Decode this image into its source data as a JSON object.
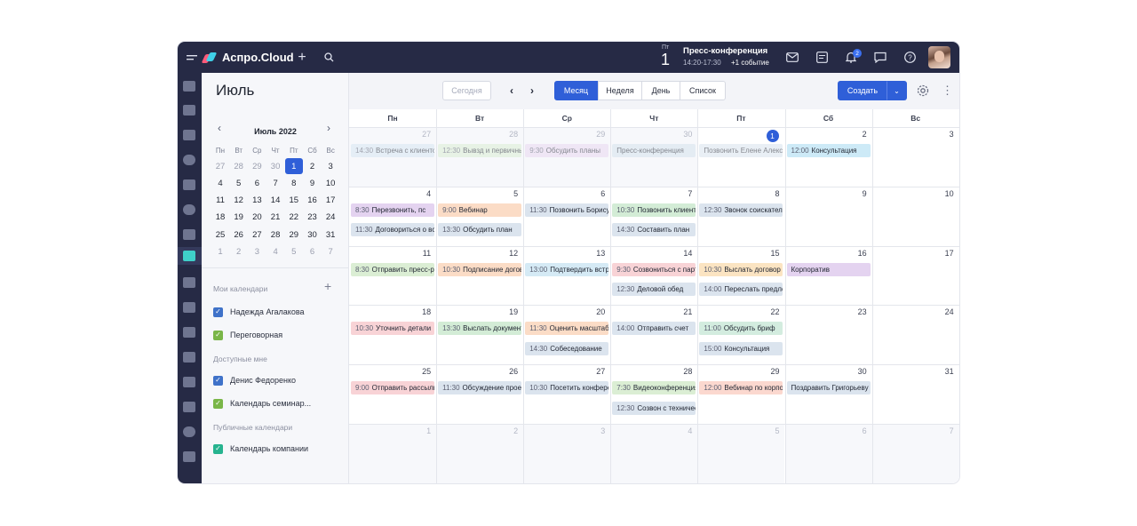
{
  "app": {
    "name": "Аспро.Cloud"
  },
  "topbar": {
    "event_day_label": "Пт",
    "event_day_num": "1",
    "event_title": "Пресс-конференция",
    "event_time": "14:20-17:30",
    "event_more": "+1 событие",
    "notif_count": "2"
  },
  "toolbar": {
    "month_title": "Июль",
    "today_label": "Сегодня",
    "views": [
      "Месяц",
      "Неделя",
      "День",
      "Список"
    ],
    "create_label": "Создать"
  },
  "mini_cal": {
    "title": "Июль 2022",
    "dow": [
      "Пн",
      "Вт",
      "Ср",
      "Чт",
      "Пт",
      "Сб",
      "Вс"
    ],
    "days": [
      [
        "27",
        "28",
        "29",
        "30",
        "1",
        "2",
        "3"
      ],
      [
        "4",
        "5",
        "6",
        "7",
        "8",
        "9",
        "10"
      ],
      [
        "11",
        "12",
        "13",
        "14",
        "15",
        "16",
        "17"
      ],
      [
        "18",
        "19",
        "20",
        "21",
        "22",
        "23",
        "24"
      ],
      [
        "25",
        "26",
        "27",
        "28",
        "29",
        "30",
        "31"
      ],
      [
        "1",
        "2",
        "3",
        "4",
        "5",
        "6",
        "7"
      ]
    ]
  },
  "sidebar": {
    "my_header": "Мои календари",
    "my": [
      "Надежда Агалакова",
      "Переговорная"
    ],
    "available_header": "Доступные мне",
    "available": [
      "Денис Федоренко",
      "Календарь семинар..."
    ],
    "public_header": "Публичные календари",
    "public": [
      "Календарь компании"
    ],
    "check_colors": [
      "#3f72c9",
      "#7ab648",
      "#3f72c9",
      "#7ab648",
      "#26b38f"
    ]
  },
  "grid": {
    "dow": [
      "Пн",
      "Вт",
      "Ср",
      "Чт",
      "Пт",
      "Сб",
      "Вс"
    ],
    "weeks": [
      [
        "27",
        "28",
        "29",
        "30",
        "1",
        "2",
        "3"
      ],
      [
        "4",
        "5",
        "6",
        "7",
        "8",
        "9",
        "10"
      ],
      [
        "11",
        "12",
        "13",
        "14",
        "15",
        "16",
        "17"
      ],
      [
        "18",
        "19",
        "20",
        "21",
        "22",
        "23",
        "24"
      ],
      [
        "25",
        "26",
        "27",
        "28",
        "29",
        "30",
        "31"
      ],
      [
        "1",
        "2",
        "3",
        "4",
        "5",
        "6",
        "7"
      ]
    ]
  },
  "events": [
    {
      "week": 0,
      "day": 0,
      "slot": 0,
      "time": "14:30",
      "title": "Встреча с клиентом",
      "color": "#d8e7f3",
      "past": true
    },
    {
      "week": 0,
      "day": 1,
      "slot": 0,
      "time": "12:30",
      "title": "Вывзд и первичный",
      "color": "#dbeed4",
      "past": true
    },
    {
      "week": 0,
      "day": 2,
      "slot": 0,
      "time": "9:30",
      "title": "Обсудить планы",
      "color": "#ead9f1",
      "past": true
    },
    {
      "week": 0,
      "day": 3,
      "slot": 0,
      "time": "",
      "title": "Пресс-конференция",
      "color": "#d5e3ee",
      "past": true
    },
    {
      "week": 0,
      "day": 4,
      "slot": 0,
      "time": "",
      "title": "Позвонить Елене Алексеевой",
      "color": "#d8e2ee",
      "past": true
    },
    {
      "week": 0,
      "day": 5,
      "slot": 0,
      "time": "12:00",
      "title": "Консультация",
      "color": "#cdeaf7",
      "past": false
    },
    {
      "week": 1,
      "day": 0,
      "slot": 0,
      "time": "8:30",
      "title": "Перезвонить, пс",
      "color": "#e4d3f0",
      "past": false
    },
    {
      "week": 1,
      "day": 0,
      "slot": 1,
      "time": "11:30",
      "title": "Договориться о встрече",
      "color": "#dbe4ee",
      "past": false
    },
    {
      "week": 1,
      "day": 1,
      "slot": 0,
      "time": "9:00",
      "title": "Вебинар",
      "color": "#fbdcc6",
      "past": false
    },
    {
      "week": 1,
      "day": 1,
      "slot": 1,
      "time": "13:30",
      "title": "Обсудить план",
      "color": "#dbe4ee",
      "past": false
    },
    {
      "week": 1,
      "day": 2,
      "slot": 0,
      "time": "11:30",
      "title": "Позвонить Борису",
      "color": "#dbe4ee",
      "past": false
    },
    {
      "week": 1,
      "day": 3,
      "slot": 0,
      "time": "10:30",
      "title": "Позвонить клиенту",
      "color": "#d3ecd6",
      "past": false
    },
    {
      "week": 1,
      "day": 3,
      "slot": 1,
      "time": "14:30",
      "title": "Составить план",
      "color": "#dbe4ee",
      "past": false
    },
    {
      "week": 1,
      "day": 4,
      "slot": 0,
      "time": "12:30",
      "title": "Звонок соискателю",
      "color": "#dbe4ee",
      "past": false
    },
    {
      "week": 2,
      "day": 0,
      "slot": 0,
      "time": "8:30",
      "title": "Отправить пресс-релиз",
      "color": "#dbeed4",
      "past": false
    },
    {
      "week": 2,
      "day": 1,
      "slot": 0,
      "time": "10:30",
      "title": "Подписание договора",
      "color": "#fbdcc6",
      "past": false
    },
    {
      "week": 2,
      "day": 2,
      "slot": 0,
      "time": "13:00",
      "title": "Подтвердить встречу",
      "color": "#d5eaf5",
      "past": false
    },
    {
      "week": 2,
      "day": 3,
      "slot": 0,
      "time": "9:30",
      "title": "Созвониться с партнером",
      "color": "#f8d3d6",
      "past": false
    },
    {
      "week": 2,
      "day": 3,
      "slot": 1,
      "time": "12:30",
      "title": "Деловой обед",
      "color": "#dbe4ee",
      "past": false
    },
    {
      "week": 2,
      "day": 4,
      "slot": 0,
      "time": "10:30",
      "title": "Выслать договор",
      "color": "#fbe4c2",
      "past": false
    },
    {
      "week": 2,
      "day": 4,
      "slot": 1,
      "time": "14:00",
      "title": "Переслать предложение",
      "color": "#dbe4ee",
      "past": false
    },
    {
      "week": 2,
      "day": 5,
      "slot": 0,
      "time": "",
      "title": "Корпоратив",
      "color": "#e4d3f0",
      "past": false
    },
    {
      "week": 3,
      "day": 0,
      "slot": 0,
      "time": "10:30",
      "title": "Уточнить детали",
      "color": "#f8d3d6",
      "past": false
    },
    {
      "week": 3,
      "day": 1,
      "slot": 0,
      "time": "13:30",
      "title": "Выслать документы",
      "color": "#d3ecd6",
      "past": false
    },
    {
      "week": 3,
      "day": 2,
      "slot": 0,
      "time": "11:30",
      "title": "Оценить масштаб",
      "color": "#fbdcc6",
      "past": false
    },
    {
      "week": 3,
      "day": 2,
      "slot": 1,
      "time": "14:30",
      "title": "Собеседование",
      "color": "#dbe4ee",
      "past": false
    },
    {
      "week": 3,
      "day": 3,
      "slot": 0,
      "time": "14:00",
      "title": "Отправить счет",
      "color": "#dbe4ee",
      "past": false
    },
    {
      "week": 3,
      "day": 4,
      "slot": 0,
      "time": "11:00",
      "title": "Обсудить бриф",
      "color": "#d3ecdf",
      "past": false
    },
    {
      "week": 3,
      "day": 4,
      "slot": 1,
      "time": "15:00",
      "title": "Консультация",
      "color": "#dbe4ee",
      "past": false
    },
    {
      "week": 4,
      "day": 0,
      "slot": 0,
      "time": "9:00",
      "title": "Отправить рассылку",
      "color": "#f8d3d6",
      "past": false
    },
    {
      "week": 4,
      "day": 1,
      "slot": 0,
      "time": "11:30",
      "title": "Обсуждение проекта",
      "color": "#dbe4ee",
      "past": false
    },
    {
      "week": 4,
      "day": 2,
      "slot": 0,
      "time": "10:30",
      "title": "Посетить конференцию",
      "color": "#dbe4ee",
      "past": false
    },
    {
      "week": 4,
      "day": 3,
      "slot": 0,
      "time": "7:30",
      "title": "Видеоконференция",
      "color": "#dbeed4",
      "past": false
    },
    {
      "week": 4,
      "day": 3,
      "slot": 1,
      "time": "12:30",
      "title": "Созвон с техническим",
      "color": "#dbe4ee",
      "past": false
    },
    {
      "week": 4,
      "day": 4,
      "slot": 0,
      "time": "12:00",
      "title": "Вебинар по корпоративу",
      "color": "#fbd8cf",
      "past": false
    },
    {
      "week": 4,
      "day": 5,
      "slot": 0,
      "time": "",
      "title": "Поздравить Григорьеву",
      "color": "#dbe4ee",
      "past": false
    }
  ]
}
